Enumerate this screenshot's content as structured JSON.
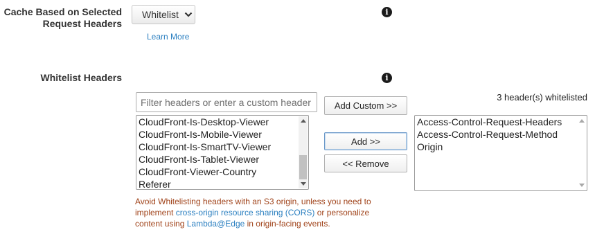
{
  "cache_headers": {
    "label_line1": "Cache Based on Selected",
    "label_line2": "Request Headers",
    "dropdown_value": "Whitelist",
    "learn_more": "Learn More"
  },
  "whitelist": {
    "label": "Whitelist Headers",
    "filter_placeholder": "Filter headers or enter a custom header",
    "add_custom_label": "Add Custom >>",
    "add_label": "Add >>",
    "remove_label": "<< Remove",
    "count_text": "3 header(s) whitelisted",
    "available_headers": [
      "CloudFront-Is-Desktop-Viewer",
      "CloudFront-Is-Mobile-Viewer",
      "CloudFront-Is-SmartTV-Viewer",
      "CloudFront-Is-Tablet-Viewer",
      "CloudFront-Viewer-Country",
      "Referer"
    ],
    "selected_headers": [
      "Access-Control-Request-Headers",
      "Access-Control-Request-Method",
      "Origin"
    ],
    "warning": {
      "part1": "Avoid Whitelisting headers with an S3 origin, unless you need to implement ",
      "link1": "cross-origin resource sharing (CORS)",
      "part2": " or personalize content using ",
      "link2": "Lambda@Edge",
      "part3": " in origin-facing events."
    }
  },
  "icons": {
    "info": "info-icon",
    "dropdown": "chevron-down-icon"
  },
  "colors": {
    "link": "#2a7fc0",
    "warning_text": "#a0431a"
  }
}
